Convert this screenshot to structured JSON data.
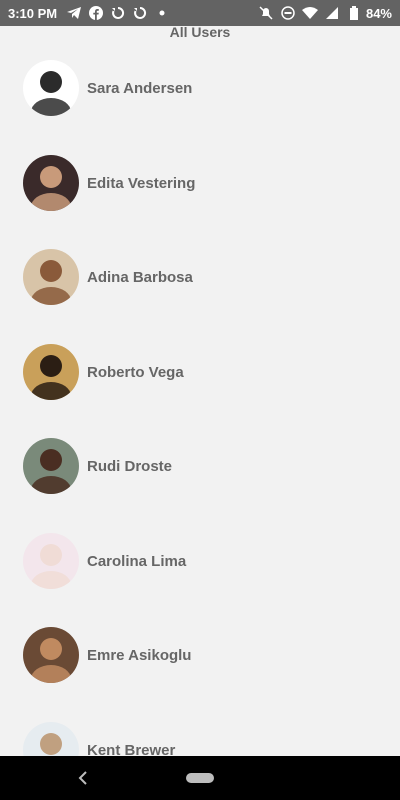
{
  "status_bar": {
    "time": "3:10 PM",
    "battery_percent": "84%",
    "left_icons": [
      "telegram-icon",
      "facebook-icon",
      "sync-icon",
      "sync-icon",
      "dot-icon"
    ],
    "right_icons": [
      "notifications-off-icon",
      "do-not-disturb-icon",
      "wifi-icon",
      "signal-icon",
      "battery-icon"
    ]
  },
  "header": {
    "title": "All Users"
  },
  "users": [
    {
      "name": "Sara Andersen",
      "avatar_bg": "#ffffff",
      "avatar_fg": "#2b2b2b"
    },
    {
      "name": "Edita Vestering",
      "avatar_bg": "#3a2a2a",
      "avatar_fg": "#c89a7a"
    },
    {
      "name": "Adina Barbosa",
      "avatar_bg": "#d8c4a8",
      "avatar_fg": "#8a5a3a"
    },
    {
      "name": "Roberto Vega",
      "avatar_bg": "#c9a05a",
      "avatar_fg": "#2b1e14"
    },
    {
      "name": "Rudi Droste",
      "avatar_bg": "#7a8a7a",
      "avatar_fg": "#4a2e22"
    },
    {
      "name": "Carolina Lima",
      "avatar_bg": "#f3e6ec",
      "avatar_fg": "#f0dcd6"
    },
    {
      "name": "Emre Asikoglu",
      "avatar_bg": "#6a4a35",
      "avatar_fg": "#c08a60"
    },
    {
      "name": "Kent Brewer",
      "avatar_bg": "#e6ecf0",
      "avatar_fg": "#c0a080"
    }
  ],
  "nav_bar": {
    "back_icon": "back-chevron-icon",
    "home_icon": "home-pill-icon"
  }
}
